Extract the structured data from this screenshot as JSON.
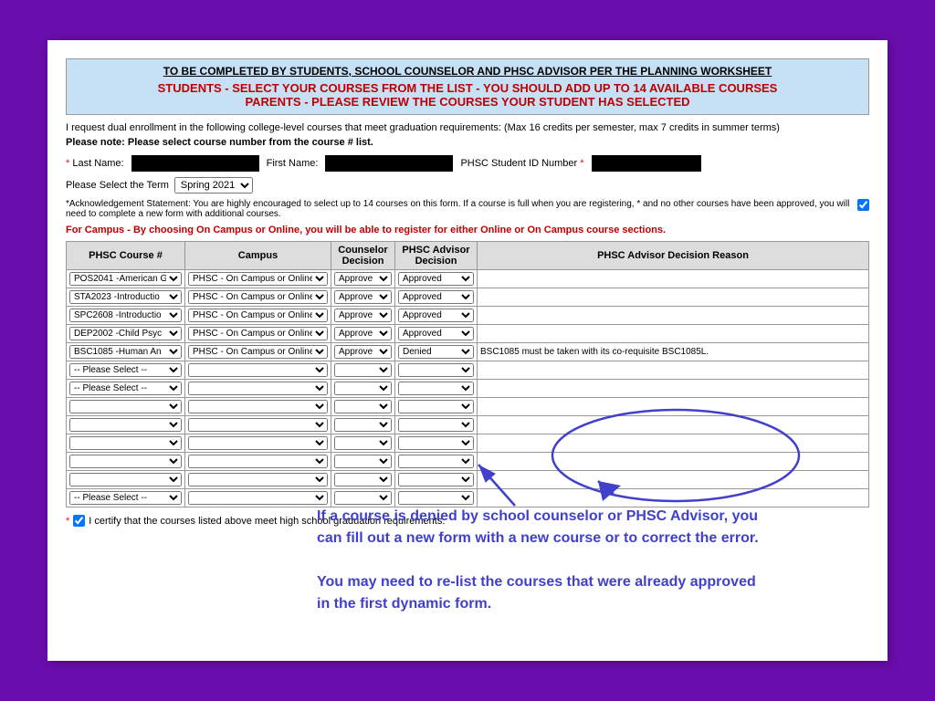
{
  "header": {
    "line1": "TO BE COMPLETED BY STUDENTS, SCHOOL COUNSELOR AND PHSC ADVISOR PER THE PLANNING WORKSHEET",
    "line2": "STUDENTS - SELECT YOUR COURSES FROM THE LIST - YOU SHOULD ADD UP TO 14 AVAILABLE COURSES",
    "line3": "PARENTS - PLEASE REVIEW THE COURSES YOUR STUDENT HAS SELECTED"
  },
  "intro": "I request dual enrollment in the following college-level courses that meet graduation requirements:  (Max 16 credits per semester, max 7 credits in summer terms)",
  "note": "Please note: Please select course number from the course # list.",
  "fields": {
    "last_name_label": "Last Name:",
    "first_name_label": "First Name:",
    "phsc_id_label": "PHSC Student ID Number",
    "term_label": "Please Select the Term",
    "term_value": "Spring 2021"
  },
  "acknowledgement": "*Acknowledgement Statement: You are highly encouraged to select up to 14 courses on this form.  If a course is full when you are registering, * and no other courses have been approved, you will need to complete a new form with additional courses.",
  "campus_note": "For Campus - By choosing On Campus or Online, you will be able to register for either Online or On Campus course sections.",
  "table": {
    "headers": [
      "PHSC Course #",
      "Campus",
      "Counselor Decision",
      "PHSC Advisor Decision",
      "PHSC Advisor Decision Reason"
    ],
    "rows": [
      {
        "course": "POS2041 -American G",
        "campus": "PHSC - On Campus or Online",
        "counselor": "Approve",
        "advisor": "Approved",
        "reason": ""
      },
      {
        "course": "STA2023 -Introductio",
        "campus": "PHSC - On Campus or Online",
        "counselor": "Approve",
        "advisor": "Approved",
        "reason": ""
      },
      {
        "course": "SPC2608 -Introductio",
        "campus": "PHSC - On Campus or Online",
        "counselor": "Approve",
        "advisor": "Approved",
        "reason": ""
      },
      {
        "course": "DEP2002 -Child Psyc",
        "campus": "PHSC - On Campus or Online",
        "counselor": "Approve",
        "advisor": "Approved",
        "reason": ""
      },
      {
        "course": "BSC1085 -Human An",
        "campus": "PHSC - On Campus or Online",
        "counselor": "Approve",
        "advisor": "Denied",
        "reason": "BSC1085 must be taken with its co-requisite BSC1085L."
      },
      {
        "course": "-- Please Select --",
        "campus": "",
        "counselor": "",
        "advisor": "",
        "reason": ""
      },
      {
        "course": "-- Please Select --",
        "campus": "",
        "counselor": "",
        "advisor": "",
        "reason": ""
      },
      {
        "course": "",
        "campus": "",
        "counselor": "",
        "advisor": "",
        "reason": ""
      },
      {
        "course": "",
        "campus": "",
        "counselor": "",
        "advisor": "",
        "reason": ""
      },
      {
        "course": "",
        "campus": "",
        "counselor": "",
        "advisor": "",
        "reason": ""
      },
      {
        "course": "",
        "campus": "",
        "counselor": "",
        "advisor": "",
        "reason": ""
      },
      {
        "course": "",
        "campus": "",
        "counselor": "",
        "advisor": "",
        "reason": ""
      },
      {
        "course": "-- Please Select --",
        "campus": "",
        "counselor": "",
        "advisor": "",
        "reason": ""
      }
    ]
  },
  "annotation": {
    "text1": "If a course is denied by school counselor or PHSC Advisor, you",
    "text2": "can fill out a new form with a new course or to correct the error.",
    "text3": "You may need to re-list the courses that were already approved",
    "text4": "in the first dynamic form."
  },
  "certify": "I certify that the courses listed above meet high school graduation requirements."
}
